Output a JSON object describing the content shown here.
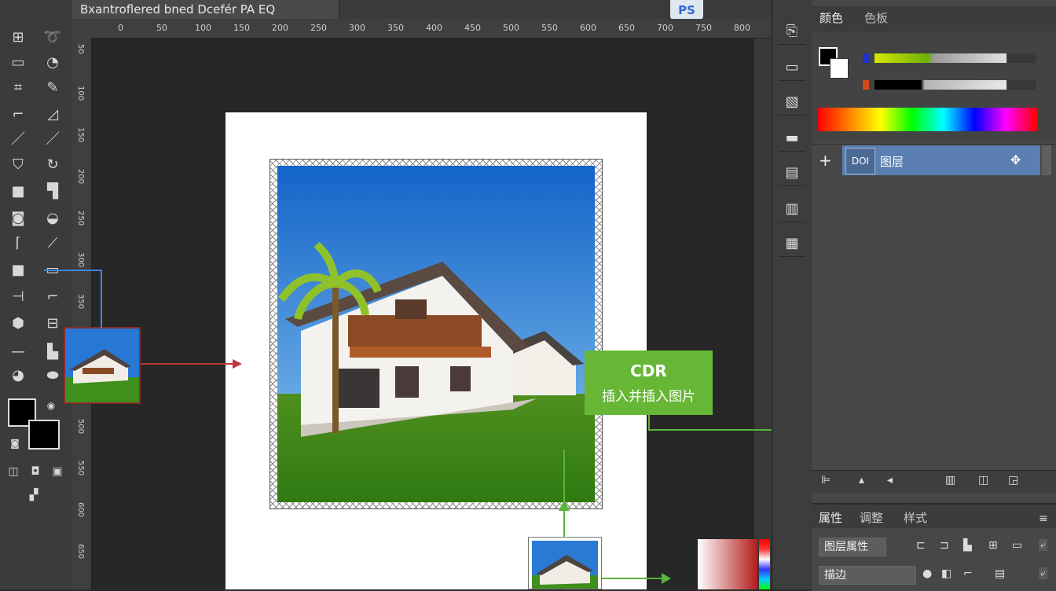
{
  "window": {
    "doc_tab_title": "Bxantroflered bned Dcefér PA EQ",
    "app_badge": "PS"
  },
  "ruler": {
    "top_ticks": [
      "0",
      "50",
      "100",
      "150",
      "200",
      "250",
      "300",
      "350",
      "400",
      "450",
      "500",
      "550",
      "600",
      "650",
      "700",
      "750",
      "800"
    ],
    "left_ticks": [
      "50",
      "100",
      "150",
      "200",
      "250",
      "300",
      "350",
      "400",
      "450",
      "500",
      "550",
      "600",
      "650"
    ]
  },
  "right_panel": {
    "tabs": [
      "颜色",
      "色板"
    ],
    "layer_thumb_label": "DOI",
    "layer_name": "图层",
    "add_icon": "+",
    "bottom_tabs": [
      "属性",
      "调整",
      "样式"
    ],
    "field_1": "图层属性",
    "field_2": "描边"
  },
  "callout": {
    "title": "CDR",
    "subtitle": "插入并插入图片"
  },
  "colors": {
    "accent_blue": "#5a7fb0",
    "callout_green": "#67b636",
    "arrow_red": "#c0343a",
    "arrow_green": "#5ab43a",
    "link_blue": "#3c8ad8"
  },
  "icons": {
    "toolbar": [
      "move-icon",
      "lasso-icon",
      "marquee-icon",
      "magic-wand-icon",
      "crop-icon",
      "eyedropper-icon",
      "slice-icon",
      "pen-icon",
      "brush-icon",
      "pencil-icon",
      "stamp-icon",
      "history-brush-icon",
      "eraser-icon",
      "gradient-icon",
      "blur-icon",
      "dodge-icon",
      "path-icon",
      "type-icon",
      "shape-icon",
      "rectangle-icon",
      "hand-icon",
      "zoom-icon"
    ]
  }
}
